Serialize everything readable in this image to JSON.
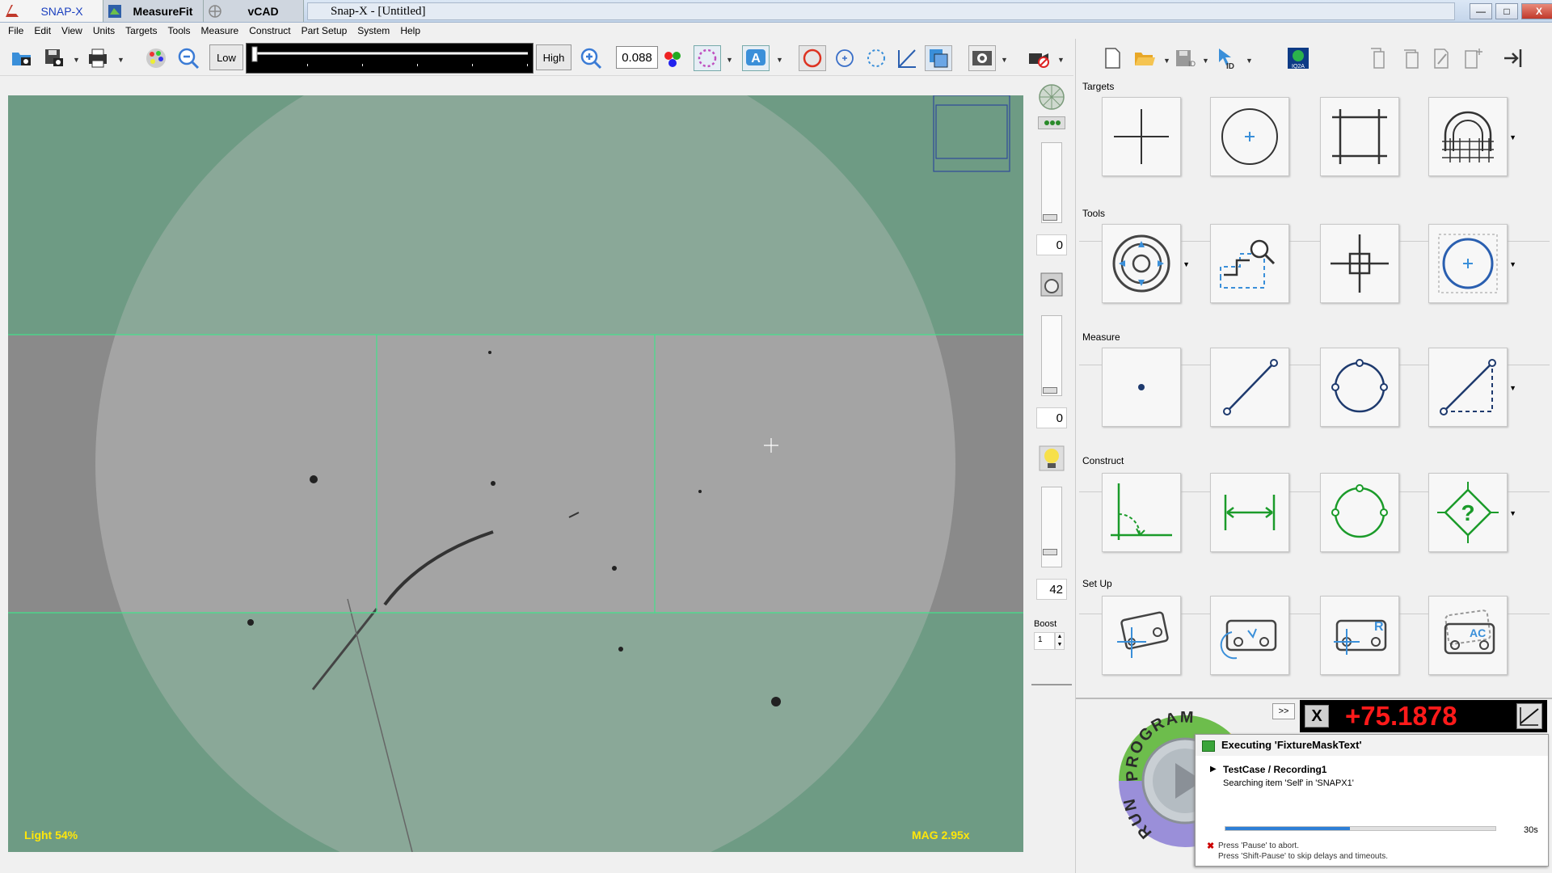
{
  "titlebar": {
    "tabs": [
      {
        "label": "SNAP-X"
      },
      {
        "label": "MeasureFit"
      },
      {
        "label": "vCAD"
      }
    ],
    "window_title": "Snap-X - [Untitled]",
    "min_label": "—",
    "max_label": "□",
    "close_label": "X"
  },
  "menu": [
    "File",
    "Edit",
    "View",
    "Units",
    "Targets",
    "Tools",
    "Measure",
    "Construct",
    "Part Setup",
    "System",
    "Help"
  ],
  "toolbar": {
    "low_label": "Low",
    "high_label": "High",
    "zoom_value": "0.088"
  },
  "viewer": {
    "light_text": "Light  54%",
    "mag_text": "MAG 2.95x",
    "colors": {
      "mask": "#6e9b84",
      "lens": "#8aa898",
      "band": "#8a8a8a",
      "lines": "#43e08a"
    }
  },
  "light_panel": {
    "value1": "0",
    "value2": "0",
    "value3": "42",
    "boost_label": "Boost",
    "boost_value": "1"
  },
  "right_panel": {
    "sections": [
      {
        "title": "Targets"
      },
      {
        "title": "Tools"
      },
      {
        "title": "Measure"
      },
      {
        "title": "Construct"
      },
      {
        "title": "Set Up"
      }
    ]
  },
  "run": {
    "program_text": "PROGRAM",
    "run_text": "RUN",
    "expand_label": ">>"
  },
  "readout": {
    "value": "+75.1878",
    "x_label": "X"
  },
  "exec": {
    "title": "Executing 'FixtureMaskText'",
    "testcase": "TestCase / Recording1",
    "searching": "Searching item 'Self' in 'SNAPX1'",
    "progress_fraction": 0.46,
    "seconds": "30s",
    "abort_mark": "✖",
    "hint1": "Press 'Pause' to abort.",
    "hint2": "Press 'Shift-Pause' to skip delays and timeouts."
  }
}
